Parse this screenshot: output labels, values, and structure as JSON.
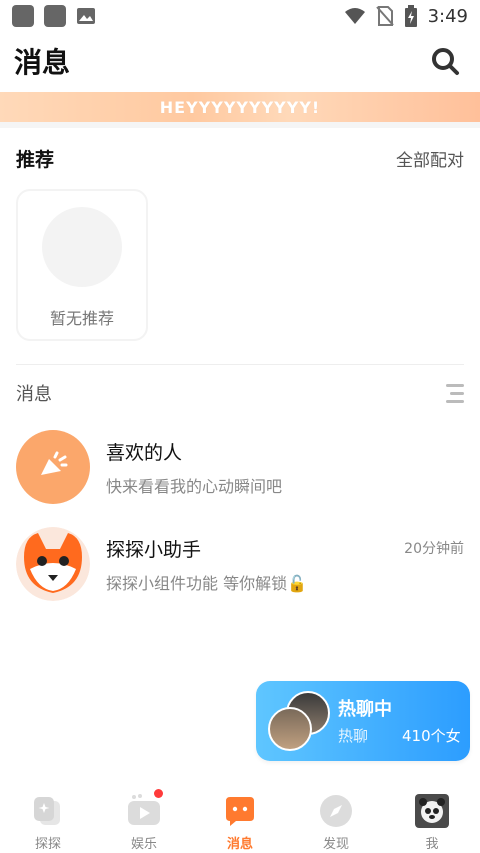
{
  "status": {
    "time": "3:49"
  },
  "header": {
    "title": "消息"
  },
  "banner": {
    "text": "HEYYYYYYYYYY!"
  },
  "recommend": {
    "title": "推荐",
    "all_link": "全部配对",
    "empty_text": "暂无推荐"
  },
  "messages": {
    "title": "消息",
    "items": [
      {
        "name": "喜欢的人",
        "preview": "快来看看我的心动瞬间吧",
        "time": ""
      },
      {
        "name": "探探小助手",
        "preview": "探探小组件功能 等你解锁🔓",
        "time": "20分钟前"
      }
    ]
  },
  "hot_chat": {
    "title": "热聊中",
    "tag": "热聊",
    "count": "410个女"
  },
  "tabbar": {
    "items": [
      {
        "label": "探探"
      },
      {
        "label": "娱乐"
      },
      {
        "label": "消息"
      },
      {
        "label": "发现"
      },
      {
        "label": "我"
      }
    ],
    "active_index": 2
  },
  "colors": {
    "accent": "#ff7a2f",
    "hot_start": "#5fc6ff",
    "hot_end": "#2c9dff",
    "badge": "#ff3b3b"
  }
}
